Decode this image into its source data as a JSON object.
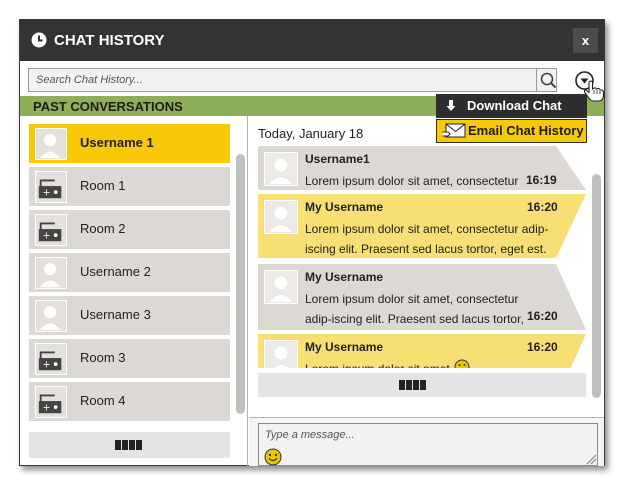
{
  "window": {
    "title": "CHAT HISTORY",
    "close_label": "x"
  },
  "search": {
    "placeholder": "Search Chat History..."
  },
  "section": {
    "title": "PAST CONVERSATIONS"
  },
  "conversations": [
    {
      "label": "Username 1",
      "type": "user",
      "active": true
    },
    {
      "label": "Room 1",
      "type": "room",
      "active": false
    },
    {
      "label": "Room 2",
      "type": "room",
      "active": false
    },
    {
      "label": "Username 2",
      "type": "user",
      "active": false
    },
    {
      "label": "Username 3",
      "type": "user",
      "active": false
    },
    {
      "label": "Room 3",
      "type": "room",
      "active": false
    },
    {
      "label": "Room 4",
      "type": "room",
      "active": false
    }
  ],
  "chat": {
    "date_label": "Today, January 18",
    "messages": [
      {
        "user": "Username1",
        "text": "Lorem ipsum dolor sit amet, consectetur",
        "time": "16:19",
        "own": false
      },
      {
        "user": "My Username",
        "text": "Lorem ipsum dolor sit amet, consectetur adip-iscing elit. Praesent sed lacus tortor, eget est.",
        "time": "16:20",
        "own": true
      },
      {
        "user": "My Username",
        "text": "Lorem ipsum dolor sit amet, consectetur adip-iscing elit. Praesent sed lacus tortor, est.",
        "time": "16:20",
        "own": false
      },
      {
        "user": "My Username",
        "text": "Lorem ipsum dolor sit amet",
        "time": "16:20",
        "own": true
      }
    ],
    "compose_placeholder": "Type a message..."
  },
  "menu": {
    "download_label": "Download Chat",
    "email_label": "Email Chat History"
  },
  "colors": {
    "titlebar": "#333333",
    "section_header": "#8fae5a",
    "accent_yellow": "#f7c909",
    "item_gray": "#dcd8d4"
  }
}
